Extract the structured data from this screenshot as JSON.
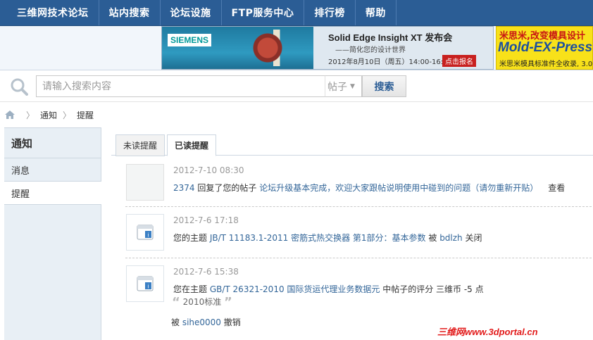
{
  "nav": {
    "items": [
      "三维网技术论坛",
      "站内搜索",
      "论坛设施",
      "FTP服务中心",
      "排行榜",
      "帮助"
    ]
  },
  "banners": {
    "left": {
      "brand": "SIEMENS",
      "title": "Solid Edge Insight XT 发布会",
      "subtitle": "——简化您的设计世界",
      "date": "2012年8月10日（周五）14:00-16:00",
      "signup": "点击报名"
    },
    "right": {
      "headline": "米思米,改变模具设计",
      "brand": "Mold-EX-Press",
      "tagline": "米思米模具标准件全收录, 3.0"
    }
  },
  "search": {
    "placeholder": "请输入搜索内容",
    "type_label": "帖子",
    "button_label": "搜索"
  },
  "breadcrumb": {
    "items": [
      "通知",
      "提醒"
    ],
    "separator": "〉"
  },
  "sidebar": {
    "title": "通知",
    "items": [
      {
        "label": "消息"
      },
      {
        "label": "提醒"
      }
    ]
  },
  "tabs": {
    "unread": "未读提醒",
    "read": "已读提醒"
  },
  "notices": [
    {
      "time": "2012-7-10 08:30",
      "user": "2374",
      "text1": " 回复了您的帖子 ",
      "thread": "论坛升级基本完成，欢迎大家跟帖说明使用中碰到的问题（请勿重新开贴）",
      "view": "查看"
    },
    {
      "time": "2012-7-6 17:18",
      "text1": "您的主题 ",
      "thread": "JB/T 11183.1-2011 密筋式热交换器 第1部分：基本参数",
      "text2": " 被 ",
      "user": "bdlzh",
      "text3": " 关闭"
    },
    {
      "time": "2012-7-6 15:38",
      "text1": "您在主题 ",
      "thread": "GB/T 26321-2010 国际货运代理业务数据元",
      "text2": " 中帖子的评分 三维币 -5 点",
      "quote": "2010标准",
      "by_prefix": "被 ",
      "user": "sihe0000",
      "by_suffix": " 撤销"
    }
  ],
  "watermark": "三维网www.3dportal.cn",
  "colors": {
    "nav_bg": "#2b5d95",
    "link": "#336699",
    "sidebar_bg": "#e8eff5",
    "watermark": "#e21a1a"
  }
}
